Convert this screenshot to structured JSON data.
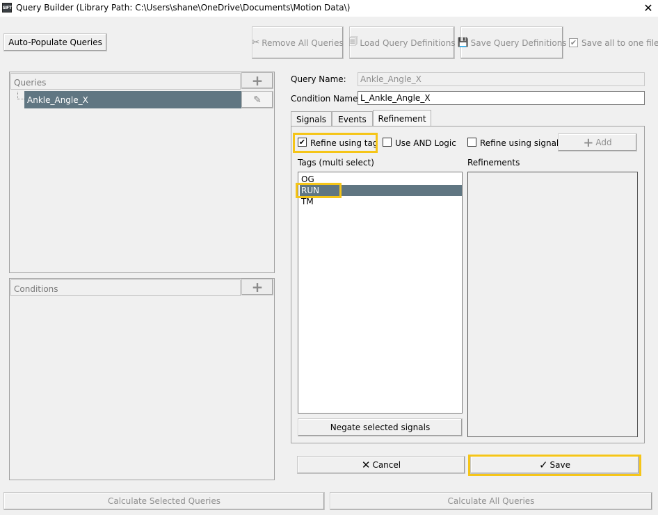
{
  "window": {
    "title": "Query Builder (Library Path: C:\\Users\\shane\\OneDrive\\Documents\\Motion Data\\)",
    "app_icon_text": "SIFT",
    "close_label": "✕"
  },
  "toolbar": {
    "auto_populate": "Auto-Populate Queries",
    "remove_all": "Remove All Queries",
    "load_defs": "Load Query Definitions",
    "save_defs": "Save Query Definitions",
    "save_all_one_file": "Save all to one file"
  },
  "queries_panel": {
    "header": "Queries",
    "items": [
      "Ankle_Angle_X"
    ],
    "add_label": "+"
  },
  "conditions_panel": {
    "header": "Conditions",
    "add_label": "+"
  },
  "form": {
    "query_name_label": "Query Name:",
    "query_name_value": "Ankle_Angle_X",
    "condition_name_label": "Condition Name:",
    "condition_name_value": "L_Ankle_Angle_X"
  },
  "tabs": [
    "Signals",
    "Events",
    "Refinement"
  ],
  "refinement": {
    "refine_tag": "Refine using tag",
    "and_logic": "Use AND Logic",
    "refine_signal": "Refine using signal",
    "add_label": "Add",
    "tags_label": "Tags (multi select)",
    "refinements_label": "Refinements",
    "tags": [
      "OG",
      "RUN",
      "TM"
    ],
    "negate_label": "Negate selected signals"
  },
  "actions": {
    "cancel": "Cancel",
    "save": "Save",
    "calc_selected": "Calculate Selected Queries",
    "calc_all": "Calculate All Queries"
  },
  "colors": {
    "selection": "#607682",
    "highlight": "#f5c518"
  }
}
